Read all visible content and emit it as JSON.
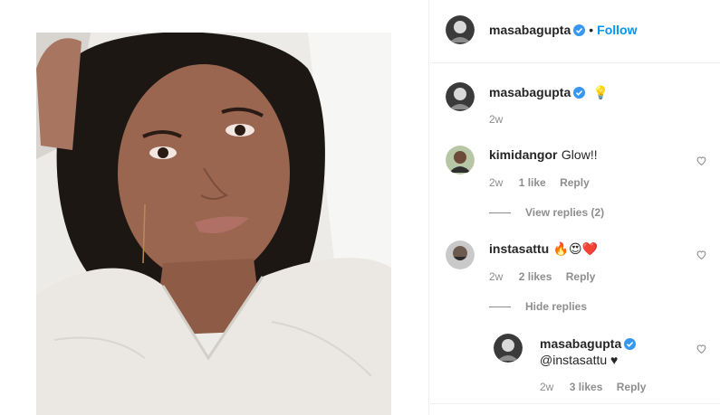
{
  "post": {
    "author": "masabagupta",
    "follow_label": "Follow",
    "dot": "•"
  },
  "caption": {
    "username": "masabagupta",
    "emoji": "💡",
    "age": "2w"
  },
  "comments": [
    {
      "username": "kimidangor",
      "text": "Glow!!",
      "age": "2w",
      "likes": "1 like",
      "reply_label": "Reply",
      "replies_toggle": "View replies (2)"
    },
    {
      "username": "instasattu",
      "text": "🔥😍❤️",
      "age": "2w",
      "likes": "2 likes",
      "reply_label": "Reply",
      "replies_toggle": "Hide replies"
    }
  ],
  "reply": {
    "username": "masabagupta",
    "text": "@instasattu ♥",
    "age": "2w",
    "likes": "3 likes",
    "reply_label": "Reply"
  },
  "colors": {
    "accent": "#0095f6",
    "verified": "#3897f0",
    "muted": "#8e8e8e"
  },
  "icons": [
    "verified-badge-icon",
    "heart-icon"
  ]
}
